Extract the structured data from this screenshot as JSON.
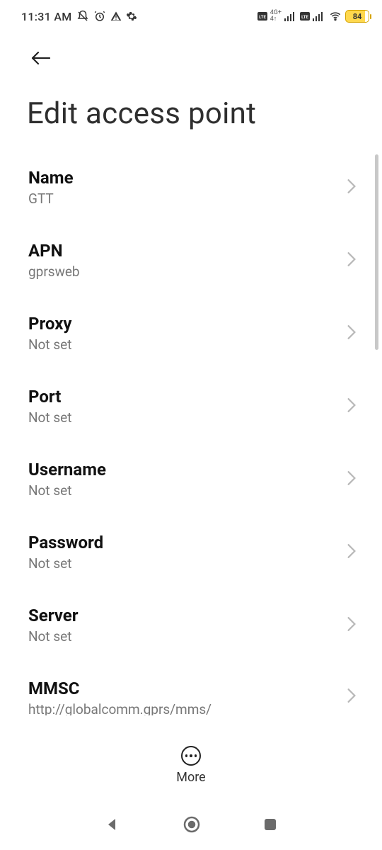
{
  "status": {
    "time": "11:31 AM",
    "battery": "84"
  },
  "header": {
    "title": "Edit access point"
  },
  "rows": {
    "name": {
      "label": "Name",
      "value": "GTT"
    },
    "apn": {
      "label": "APN",
      "value": "gprsweb"
    },
    "proxy": {
      "label": "Proxy",
      "value": "Not set"
    },
    "port": {
      "label": "Port",
      "value": "Not set"
    },
    "username": {
      "label": "Username",
      "value": "Not set"
    },
    "password": {
      "label": "Password",
      "value": "Not set"
    },
    "server": {
      "label": "Server",
      "value": "Not set"
    },
    "mmsc": {
      "label": "MMSC",
      "value": "http://globalcomm.gprs/mms/"
    }
  },
  "footer": {
    "more": "More"
  }
}
